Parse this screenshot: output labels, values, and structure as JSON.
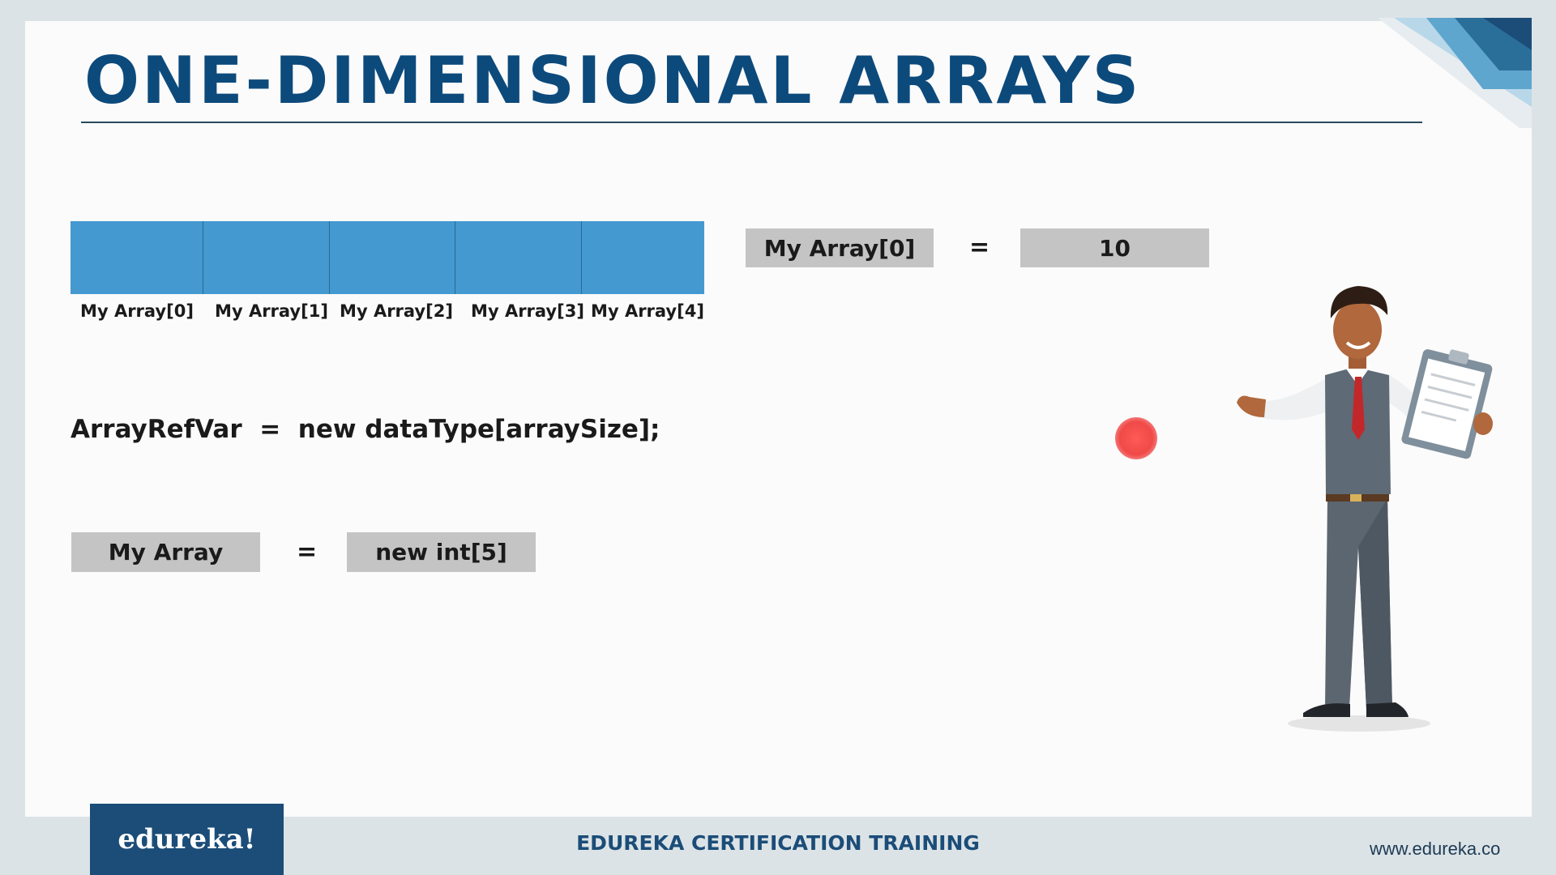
{
  "slide": {
    "title": "ONE-DIMENSIONAL ARRAYS"
  },
  "array_diagram": {
    "cells": [
      {
        "label": "My Array[0]"
      },
      {
        "label": "My Array[1]"
      },
      {
        "label": "My Array[2]"
      },
      {
        "label": "My Array[3]"
      },
      {
        "label": "My Array[4]"
      }
    ],
    "cell_color": "#4499d1"
  },
  "access_example": {
    "left": "My Array[0]",
    "operator": "=",
    "right": "10"
  },
  "syntax_line": "ArrayRefVar  =  new dataType[arraySize];",
  "declaration_example": {
    "left": "My Array",
    "operator": "=",
    "right": "new int[5]"
  },
  "footer": {
    "logo": "edureka!",
    "title": "EDUREKA CERTIFICATION TRAINING",
    "url": "www.edureka.co"
  },
  "colors": {
    "brand_blue": "#1b4d78",
    "title_blue": "#0d4a7c",
    "box_gray": "#c4c4c4",
    "pointer_red": "#f04a48"
  },
  "icons": {
    "pointer": "laser-pointer-dot",
    "character": "presenter-with-clipboard-illustration"
  }
}
